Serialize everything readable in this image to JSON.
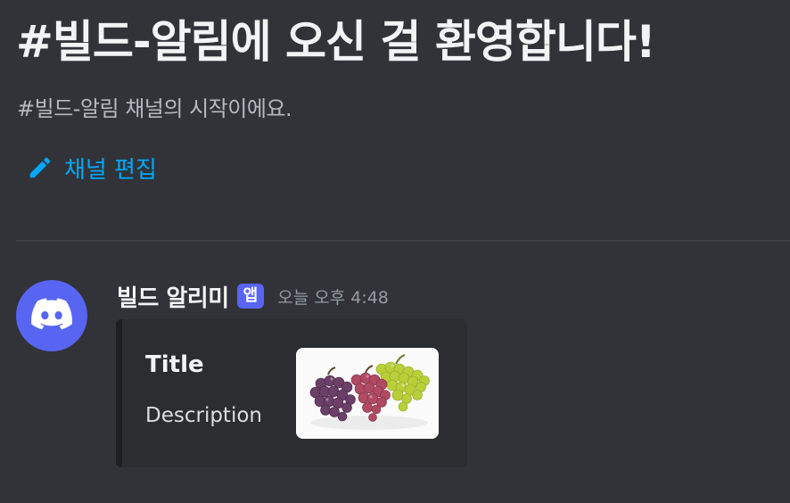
{
  "welcome": {
    "title": "#빌드-알림에 오신 걸 환영합니다!",
    "subtitle": "#빌드-알림 채널의 시작이에요.",
    "edit_channel_label": "채널 편집"
  },
  "message": {
    "username": "빌드 알리미",
    "badge": "앱",
    "timestamp": "오늘 오후 4:48",
    "avatar_icon": "discord-logo-icon",
    "embed": {
      "title": "Title",
      "description": "Description",
      "thumbnail": "grapes-image"
    }
  },
  "colors": {
    "background": "#313338",
    "link": "#00a8fc",
    "brand": "#5865f2",
    "embed_background": "#2b2d31"
  }
}
